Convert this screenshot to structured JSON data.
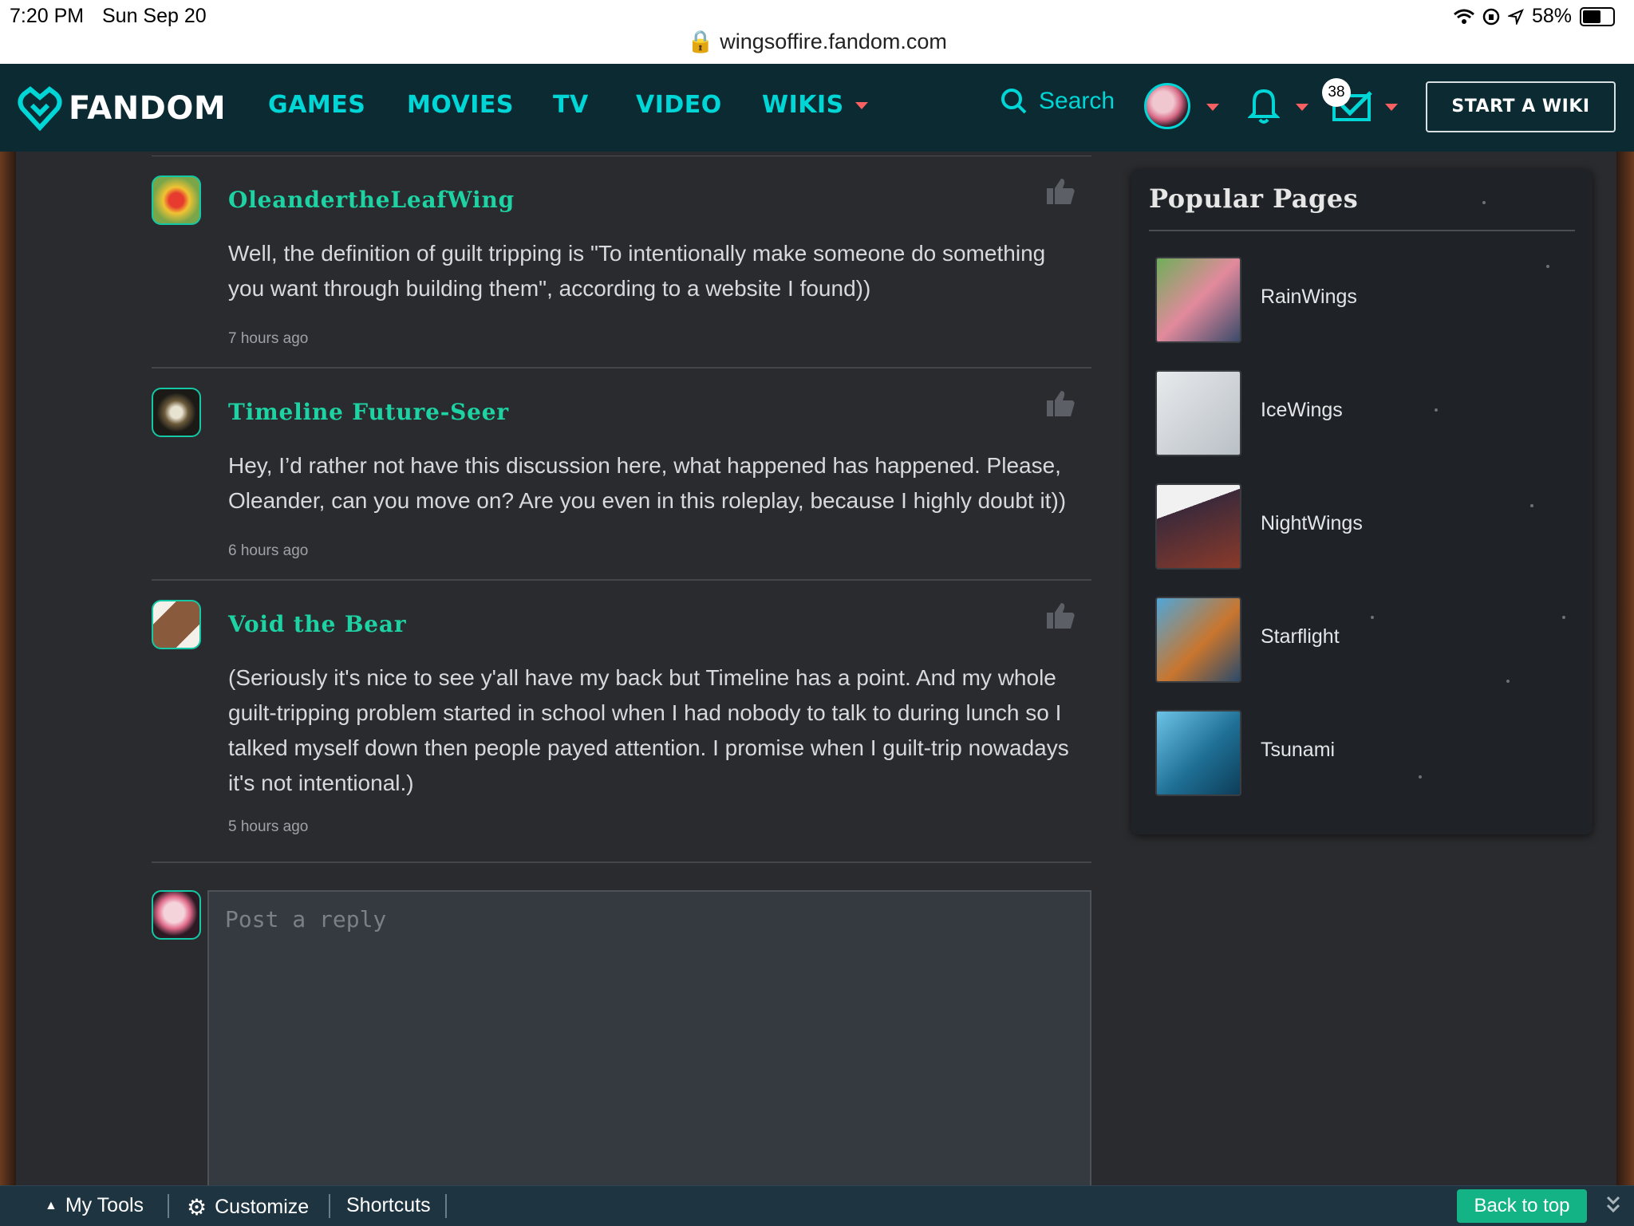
{
  "status_bar": {
    "time": "7:20 PM",
    "date": "Sun Sep 20",
    "battery": "58%",
    "url": "wingsoffire.fandom.com"
  },
  "nav": {
    "logo": "FANDOM",
    "links": [
      "GAMES",
      "MOVIES",
      "TV",
      "VIDEO",
      "WIKIS"
    ],
    "search_label": "Search",
    "notification_count": "38",
    "start_wiki": "START A WIKI"
  },
  "comments": [
    {
      "author": "OleandertheLeafWing",
      "text": "Well, the definition of guilt tripping is \"To intentionally make someone do something you want through building them\", according to a website I found))",
      "time": "7 hours ago"
    },
    {
      "author": "Timeline Future-Seer",
      "text": "Hey, I’d rather not have this discussion here, what happened has happened. Please, Oleander, can you move on? Are you even in this roleplay, because I highly doubt it))",
      "time": "6 hours ago"
    },
    {
      "author": "Void the Bear",
      "text": "(Seriously it's nice to see y'all have my back but Timeline has a point. And my whole guilt-tripping problem started in school when I had nobody to talk to during lunch so I talked myself down then people payed attention. I promise when I guilt-trip nowadays it's not intentional.)",
      "time": "5 hours ago"
    }
  ],
  "reply": {
    "placeholder": "Post a reply"
  },
  "popular_pages": {
    "title": "Popular Pages",
    "items": [
      "RainWings",
      "IceWings",
      "NightWings",
      "Starflight",
      "Tsunami"
    ]
  },
  "toolbar": {
    "my_tools": "My Tools",
    "customize": "Customize",
    "shortcuts": "Shortcuts",
    "back_to_top": "Back to top"
  },
  "colors": {
    "nav_bg": "#0b2a32",
    "accent_cyan": "#00d6d6",
    "username_green": "#1dd2a3",
    "caret_red": "#fa5f62",
    "back_to_top_green": "#14b386"
  }
}
